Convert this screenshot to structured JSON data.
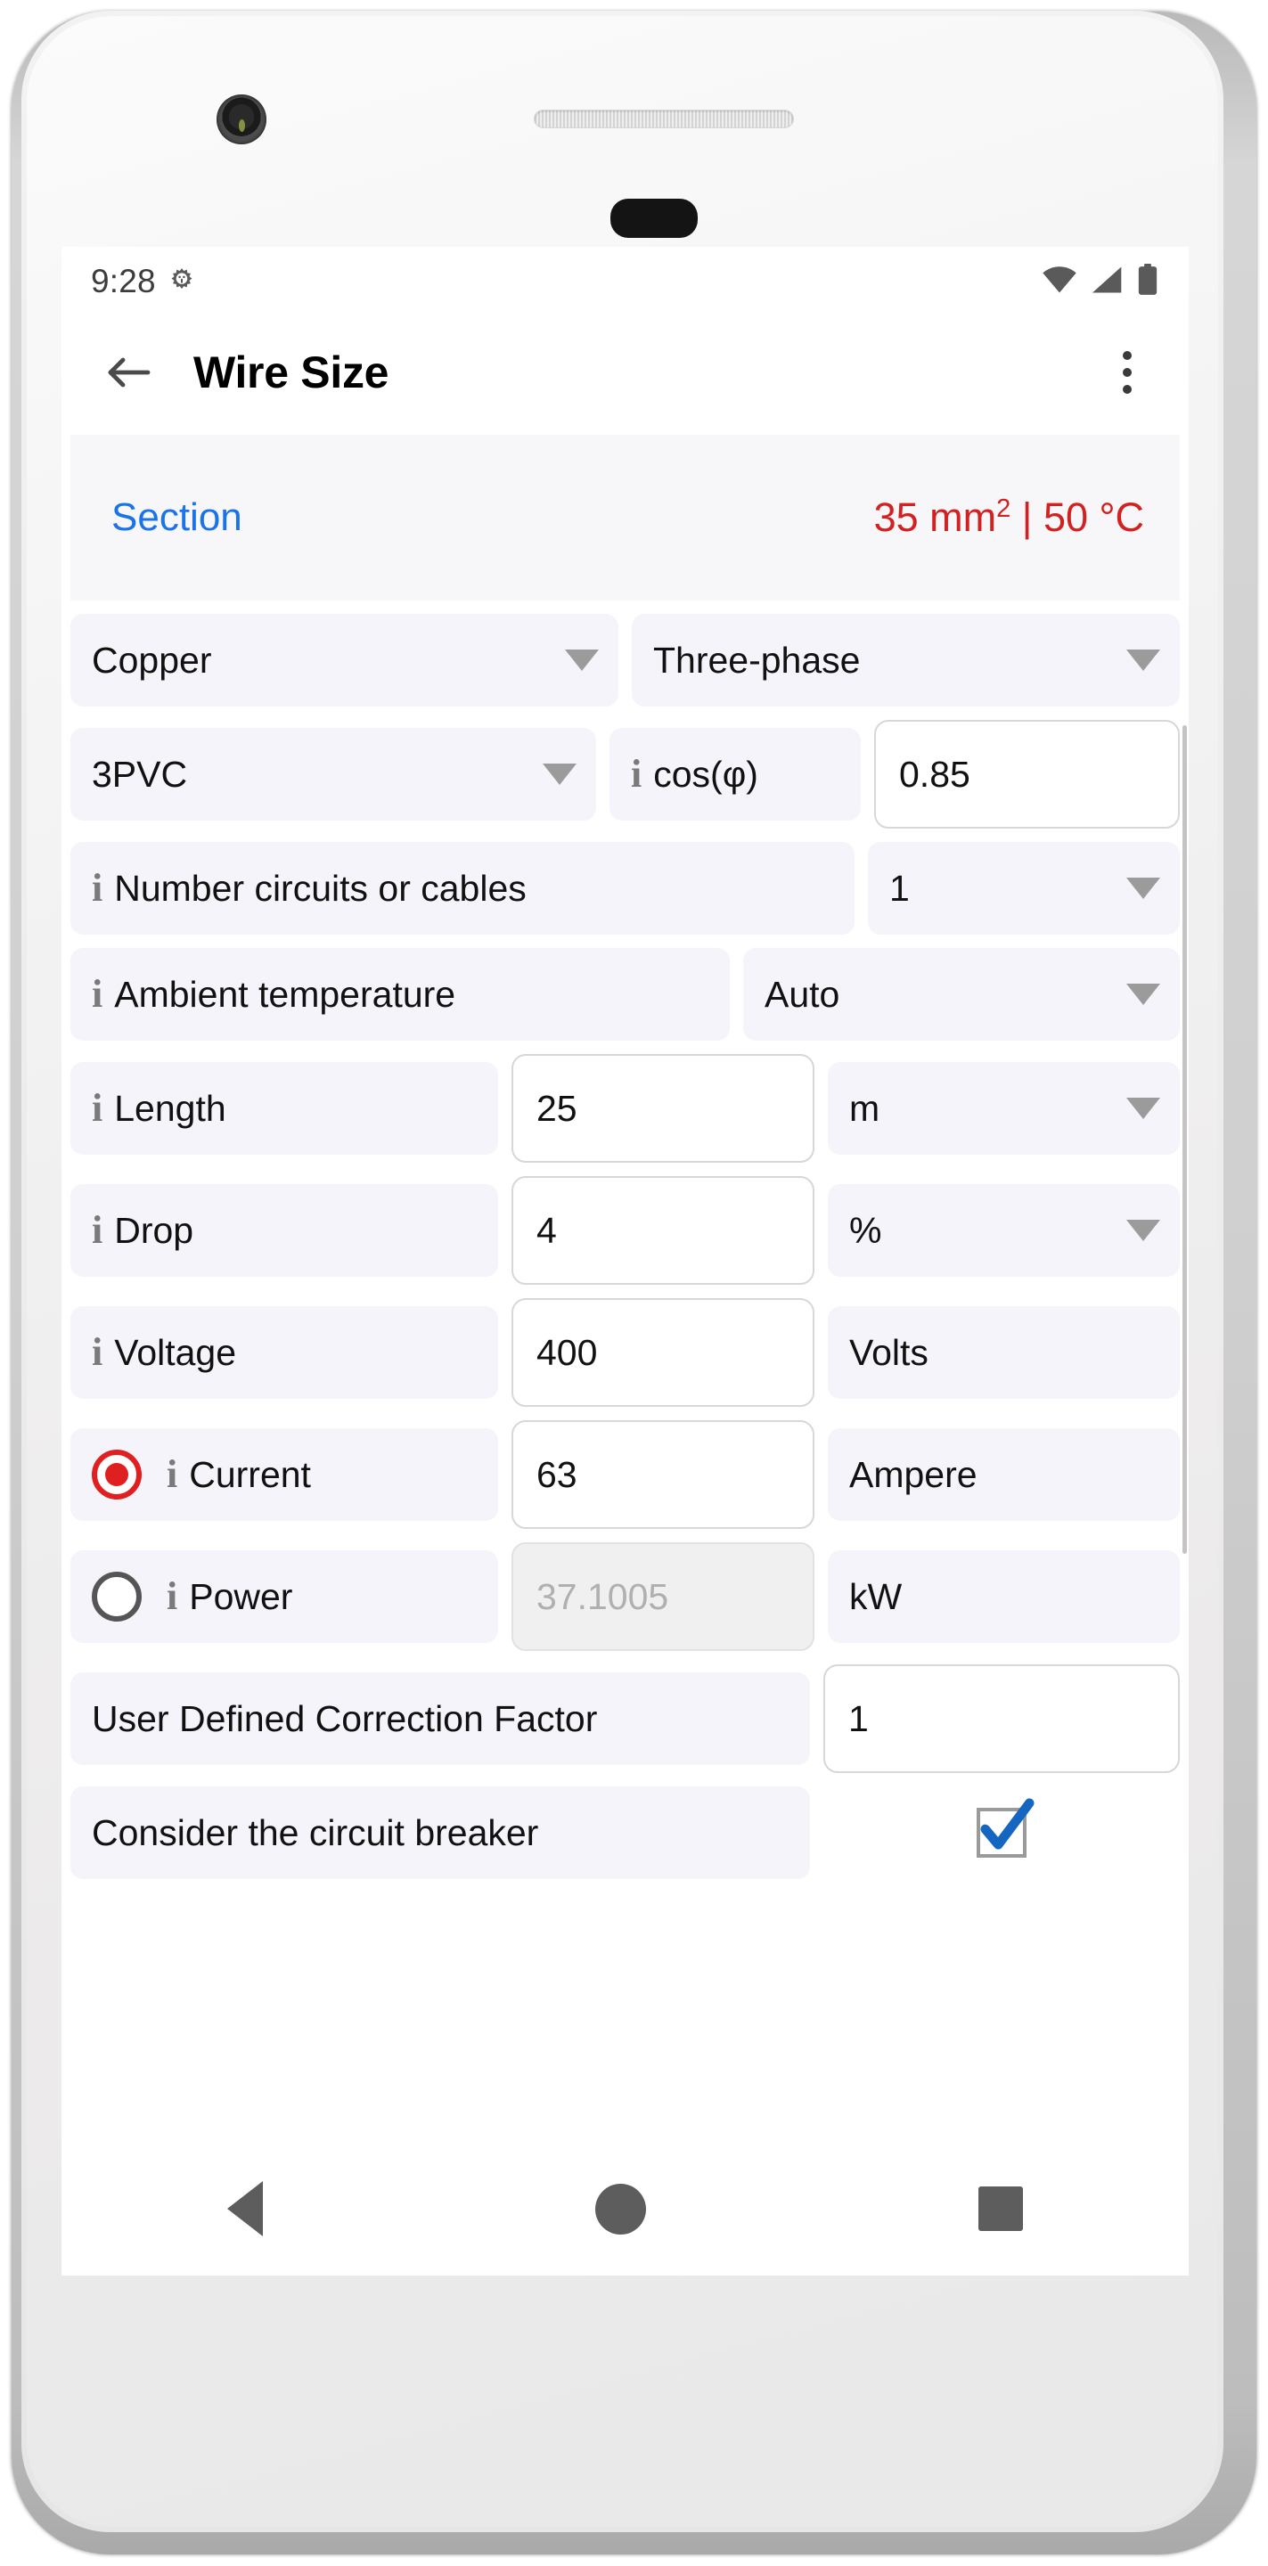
{
  "statusbar": {
    "time": "9:28",
    "left_icon": "gear-icon",
    "icons": [
      "wifi-icon",
      "signal-icon",
      "battery-icon"
    ]
  },
  "appbar": {
    "back_icon": "back-arrow-icon",
    "title": "Wire Size",
    "overflow_icon": "more-vertical-icon"
  },
  "section": {
    "label": "Section",
    "value_number": "35 mm",
    "value_sup": "2",
    "value_rest": " | 50 °C",
    "label_color": "#1a73e8",
    "value_color": "#d32020"
  },
  "form": {
    "conductor": {
      "value": "Copper"
    },
    "phases": {
      "value": "Three-phase"
    },
    "insulation": {
      "value": "3PVC"
    },
    "cosphi": {
      "label": "cos(φ)",
      "value": "0.85"
    },
    "circuits": {
      "label": "Number circuits or cables",
      "value": "1"
    },
    "ambient": {
      "label": "Ambient temperature",
      "value": "Auto"
    },
    "length": {
      "label": "Length",
      "value": "25",
      "unit": "m"
    },
    "drop": {
      "label": "Drop",
      "value": "4",
      "unit": "%"
    },
    "voltage": {
      "label": "Voltage",
      "value": "400",
      "unit": "Volts"
    },
    "current": {
      "label": "Current",
      "value": "63",
      "unit": "Ampere",
      "selected": true
    },
    "power": {
      "label": "Power",
      "value": "37.1005",
      "unit": "kW",
      "selected": false
    },
    "correction_factor": {
      "label": "User Defined Correction Factor",
      "value": "1"
    },
    "circuit_breaker": {
      "label": "Consider the circuit breaker",
      "checked": true
    }
  },
  "navbar": {
    "back": "nav-back-icon",
    "home": "nav-home-icon",
    "recents": "nav-recents-icon"
  }
}
